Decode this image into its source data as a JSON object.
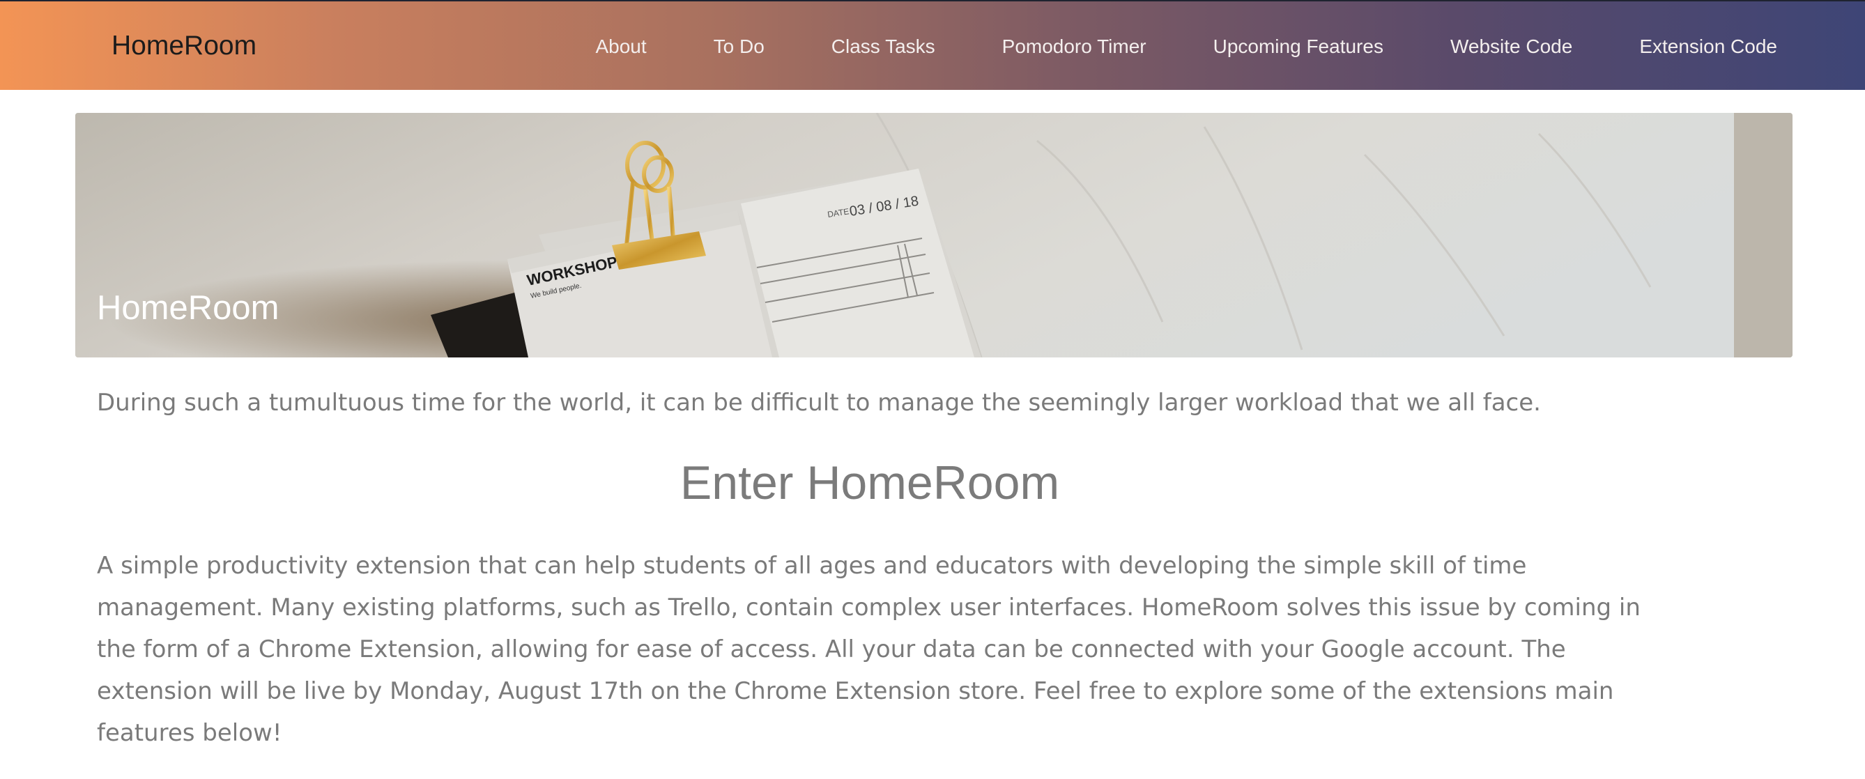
{
  "navbar": {
    "brand": "HomeRoom",
    "links": [
      {
        "label": "About"
      },
      {
        "label": "To Do"
      },
      {
        "label": "Class Tasks"
      },
      {
        "label": "Pomodoro Timer"
      },
      {
        "label": "Upcoming Features"
      },
      {
        "label": "Website Code"
      },
      {
        "label": "Extension Code"
      }
    ],
    "gradient_start": "#f39455",
    "gradient_end": "#3e4576"
  },
  "hero": {
    "title": "HomeRoom",
    "photo_text": {
      "brand": "WORKSHOP",
      "tagline": "We build people.",
      "date_label": "DATE",
      "date_value": "03 / 08 / 18"
    }
  },
  "main": {
    "intro": "During such a tumultuous time for the world, it can be difficult to manage the seemingly larger workload that we all face.",
    "heading": "Enter HomeRoom",
    "description": "A simple productivity extension that can help students of all ages and educators with developing the simple skill of time management. Many existing platforms, such as Trello, contain complex user interfaces. HomeRoom solves this issue by coming in the form of a Chrome Extension, allowing for ease of access. All your data can be connected with your Google account. The extension will be live by Monday, August 17th on the Chrome Extension store. Feel free to explore some of the extensions main features below!"
  }
}
